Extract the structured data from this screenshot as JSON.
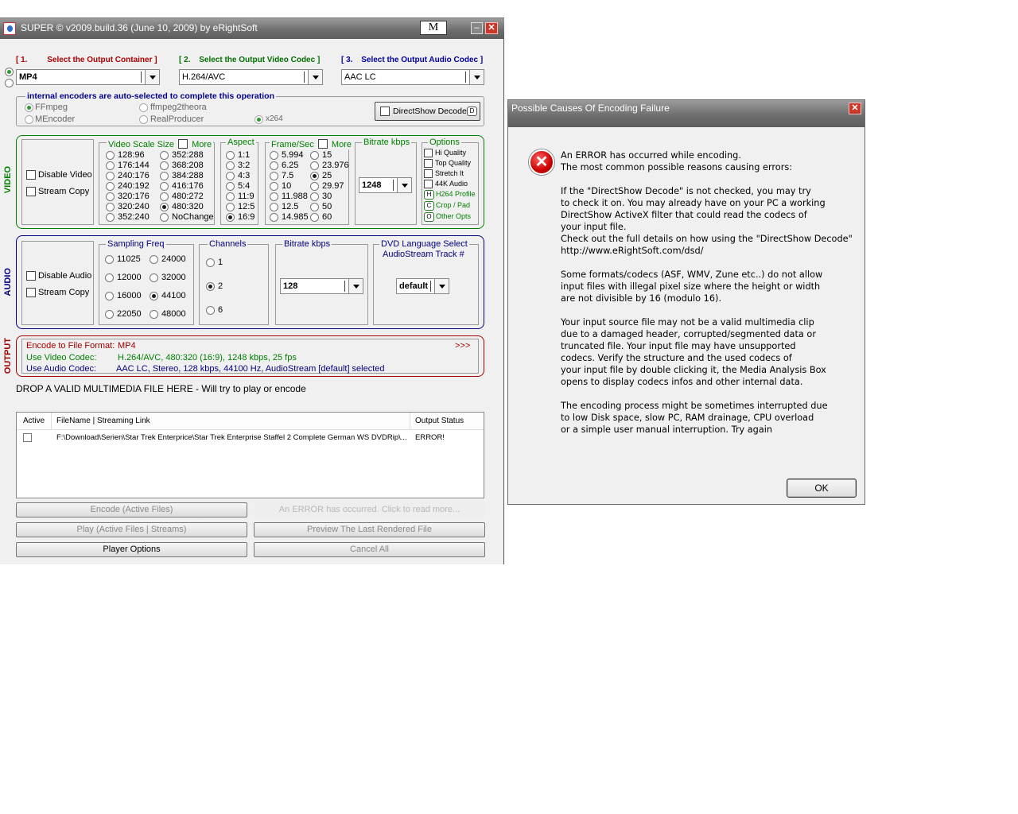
{
  "main_window": {
    "title": "SUPER © v2009.build.36 (June 10, 2009) by eRightSoft",
    "m_button": "M",
    "minimize_glyph": "–",
    "close_glyph": "✕"
  },
  "steps": {
    "container_num": "[ 1.",
    "container_label": "Select the Output Container ]",
    "video_num": "[ 2.",
    "video_label": "Select the Output Video Codec ]",
    "audio_num": "[ 3.",
    "audio_label": "Select the Output Audio Codec ]",
    "container_value": "MP4",
    "video_value": "H.264/AVC",
    "audio_value": "AAC LC"
  },
  "encoders": {
    "title": "internal encoders are auto-selected to complete this operation",
    "ffmpeg": "FFmpeg",
    "ffmpeg2theora": "ffmpeg2theora",
    "mencoder": "MEncoder",
    "realproducer": "RealProducer",
    "x264": "x264",
    "directshow": "DirectShow Decode",
    "directshow_icon": "D"
  },
  "video": {
    "section_label": "VIDEO",
    "disable": "Disable Video",
    "stream_copy": "Stream Copy",
    "scale_title": "Video Scale Size",
    "scale_more": "More",
    "scale_left": [
      "128:96",
      "176:144",
      "240:176",
      "240:192",
      "320:176",
      "320:240",
      "352:240"
    ],
    "scale_right": [
      "352:288",
      "368:208",
      "384:288",
      "416:176",
      "480:272",
      "480:320",
      "NoChange"
    ],
    "aspect_title": "Aspect",
    "aspect": [
      "1:1",
      "3:2",
      "4:3",
      "5:4",
      "11:9",
      "12:5",
      "16:9"
    ],
    "fps_title": "Frame/Sec",
    "fps_more": "More",
    "fps_left": [
      "5.994",
      "6.25",
      "7.5",
      "10",
      "11.988",
      "12.5",
      "14.985"
    ],
    "fps_right": [
      "15",
      "23.976",
      "25",
      "29.97",
      "30",
      "50",
      "60"
    ],
    "bitrate_title": "Bitrate  kbps",
    "bitrate_value": "1248",
    "options_title": "Options",
    "options": [
      "Hi Quality",
      "Top Quality",
      "Stretch It",
      "44K Audio"
    ],
    "h264_profile": "H264 Profile",
    "crop_pad": "Crop / Pad",
    "other_opts": "Other Opts",
    "h264_icon": "H",
    "crop_icon": "C",
    "other_icon": "O"
  },
  "audio": {
    "section_label": "AUDIO",
    "disable": "Disable Audio",
    "stream_copy": "Stream Copy",
    "freq_title": "Sampling Freq",
    "freq_left": [
      "11025",
      "12000",
      "16000",
      "22050"
    ],
    "freq_right": [
      "24000",
      "32000",
      "44100",
      "48000"
    ],
    "channels_title": "Channels",
    "channels": [
      "1",
      "2",
      "6"
    ],
    "bitrate_title": "Bitrate  kbps",
    "bitrate_value": "128",
    "dvd_title": "DVD Language Select",
    "dvd_subtitle": "AudioStream  Track #",
    "dvd_value": "default"
  },
  "output": {
    "section_label": "OUTPUT",
    "format_label": "Encode to File Format:",
    "format_value": "MP4",
    "more": ">>>",
    "video_label": "Use Video Codec:",
    "video_value": "H.264/AVC,  480:320 (16:9),  1248 kbps,  25 fps",
    "audio_label": "Use Audio Codec:",
    "audio_value": "AAC LC,  Stereo,  128 kbps,  44100 Hz,  AudioStream [default] selected"
  },
  "drop_text": "DROP A VALID MULTIMEDIA FILE HERE - Will try to play or encode",
  "file_table": {
    "col_active": "Active",
    "col_filename": "FileName  |  Streaming Link",
    "col_status": "Output Status",
    "rows": [
      {
        "file": "F:\\Download\\Serien\\Star Trek Enterprice\\Star Trek Enterprise Staffel 2 Complete German WS DVDRip\\...",
        "status": "ERROR!"
      }
    ]
  },
  "buttons": {
    "encode": "Encode (Active Files)",
    "error_info": "An ERROR has occurred. Click to read more...",
    "play": "Play (Active Files | Streams)",
    "preview": "Preview The Last Rendered File",
    "player_options": "Player Options",
    "cancel_all": "Cancel All"
  },
  "dialog": {
    "title": "Possible Causes Of Encoding Failure",
    "close_glyph": "✕",
    "error_glyph": "✕",
    "p1": "An ERROR has occurred while encoding.\nThe most common possible reasons causing errors:",
    "p2": "If the \"DirectShow Decode\" is not checked, you may try\nto check it on. You may already have on your PC a working\nDirectShow ActiveX filter that could read the codecs of\nyour input file.\nCheck out the full details on how using the \"DirectShow Decode\"\nhttp://www.eRightSoft.com/dsd/",
    "p3": "Some formats/codecs (ASF, WMV, Zune etc..) do not allow\ninput files with illegal pixel size where the height or width\nare not divisible by 16 (modulo 16).",
    "p4": "Your input source file may not be a valid multimedia clip\ndue to a damaged header, corrupted/segmented data or\ntruncated file. Your input file may have unsupported\ncodecs. Verify the structure and the used codecs of\nyour input file by double clicking it, the Media Analysis Box\nopens to display codecs infos and other internal data.",
    "p5": "The encoding process might be sometimes interrupted due\nto low Disk space, slow PC, RAM drainage, CPU overload\nor a simple user manual interruption. Try again",
    "ok": "OK"
  },
  "colors": {
    "video_green": "#008000",
    "audio_blue": "#000080",
    "output_red": "#a00000"
  }
}
